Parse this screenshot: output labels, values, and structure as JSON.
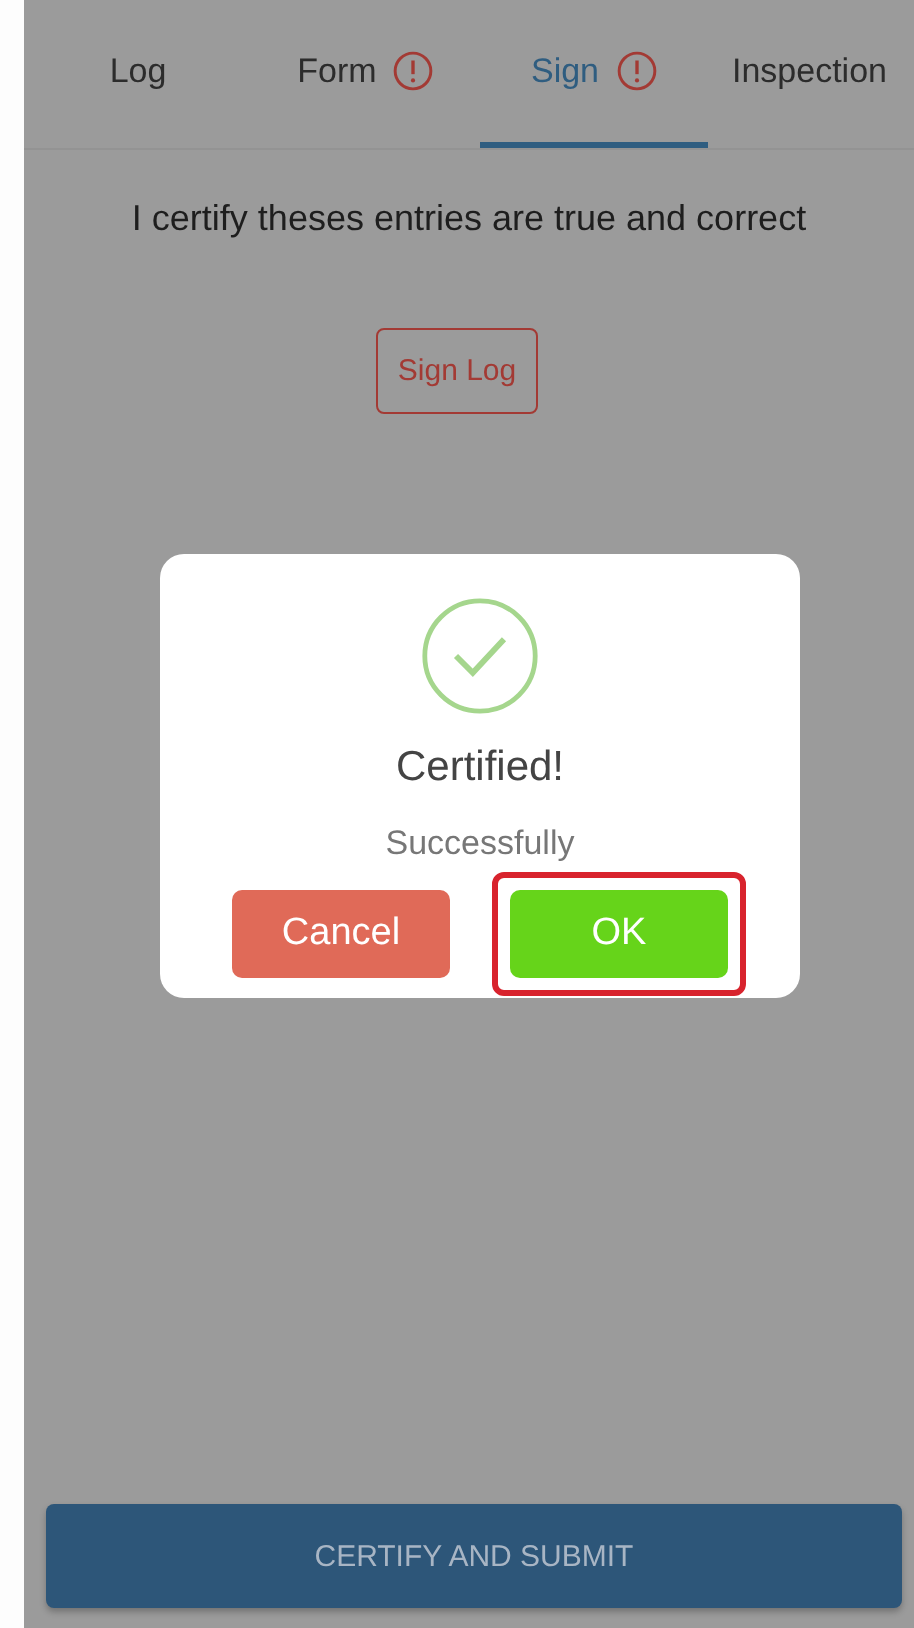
{
  "tabs": [
    {
      "label": "Log",
      "alert": false,
      "selected": false
    },
    {
      "label": "Form",
      "alert": true,
      "selected": false
    },
    {
      "label": "Sign",
      "alert": true,
      "selected": true
    },
    {
      "label": "Inspection",
      "alert": false,
      "selected": false
    }
  ],
  "statement": "I certify theses entries are true and correct",
  "sign_button": "Sign Log",
  "dialog": {
    "title": "Certified!",
    "message": "Successfully",
    "buttons": [
      {
        "label": "Cancel",
        "kind": "cancel",
        "highlighted": false
      },
      {
        "label": "OK",
        "kind": "confirm",
        "highlighted": true
      }
    ]
  },
  "submit_button": "CERTIFY AND SUBMIT"
}
